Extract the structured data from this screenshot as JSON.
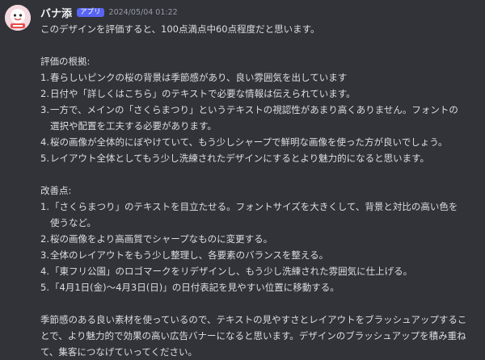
{
  "message": {
    "username": "バナ添",
    "badge": "アプリ",
    "timestamp": "2024/05/04 01:22",
    "avatar_icon": "banner-logo-icon",
    "intro": "このデザインを評価すると、100点満点中60点程度だと思います。",
    "evaluation_heading": "評価の根拠:",
    "evaluation_items": [
      {
        "num": "1.",
        "text": "春らしいピンクの桜の背景は季節感があり、良い雰囲気を出しています"
      },
      {
        "num": "2.",
        "text": "日付や「詳しくはこちら」のテキストで必要な情報は伝えられています。"
      },
      {
        "num": "3.",
        "text": "一方で、メインの「さくらまつり」というテキストの視認性があまり高くありません。フォントの選択や配置を工夫する必要があります。"
      },
      {
        "num": "4.",
        "text": "桜の画像が全体的にぼやけていて、もう少しシャープで鮮明な画像を使った方が良いでしょう。"
      },
      {
        "num": "5.",
        "text": "レイアウト全体としてもう少し洗練されたデザインにするとより魅力的になると思います。"
      }
    ],
    "improvement_heading": "改善点:",
    "improvement_items": [
      {
        "num": "1.",
        "text": "「さくらまつり」のテキストを目立たせる。フォントサイズを大きくして、背景と対比の高い色を使うなど。"
      },
      {
        "num": "2.",
        "text": "桜の画像をより高画質でシャープなものに変更する。"
      },
      {
        "num": "3.",
        "text": "全体のレイアウトをもう少し整理し、各要素のバランスを整える。"
      },
      {
        "num": "4.",
        "text": "「東フリ公園」のロゴマークをリデザインし、もう少し洗練された雰囲気に仕上げる。"
      },
      {
        "num": "5.",
        "text": "「4月1日(金)〜4月3日(日)」の日付表記を見やすい位置に移動する。"
      }
    ],
    "closing": "季節感のある良い素材を使っているので、テキストの見やすさとレイアウトをブラッシュアップすることで、より魅力的で効果の高い広告バナーになると思います。デザインのブラッシュアップを積み重ねて、集客につなげていってください。",
    "colors": {
      "background": "#313338",
      "text": "#dbdee1",
      "username": "#f2f3f5",
      "badge": "#5865f2",
      "timestamp": "#949ba4"
    }
  }
}
